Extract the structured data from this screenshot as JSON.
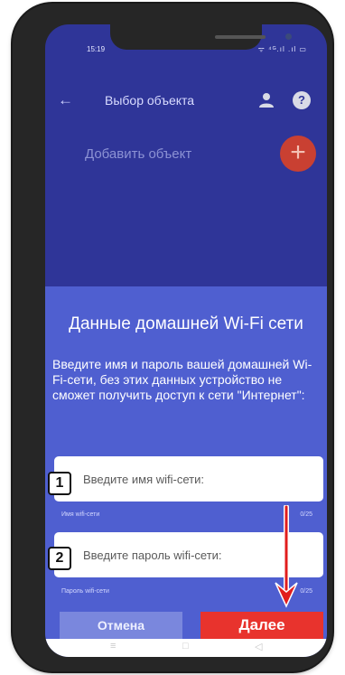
{
  "status_bar": {
    "time": "15:19",
    "icons_text": "ᯤ ⁴ᴳ.ıl .ıl ▭"
  },
  "toolbar": {
    "title": "Выбор объекта",
    "back_icon": "←",
    "help_icon": "?"
  },
  "add_object": {
    "label": "Добавить объект",
    "button_icon": "+"
  },
  "wifi_dialog": {
    "title": "Данные домашней Wi-Fi сети",
    "description": "Введите имя и пароль вашей домашней Wi-Fi-сети, без этих данных устройство не сможет получить доступ к сети \"Интернет\":",
    "name_field": {
      "step_number": "1",
      "placeholder": "Введите имя wifi-сети:",
      "helper": "Имя wifi-сети",
      "counter": "0/25"
    },
    "password_field": {
      "step_number": "2",
      "placeholder": "Введите пароль wifi-сети:",
      "helper": "Пароль wifi-сети",
      "counter": "0/25"
    },
    "cancel_label": "Отмена",
    "next_label": "Далее"
  },
  "nav_bar": {
    "menu_icon": "≡",
    "home_icon": "□",
    "back_icon": "◁"
  },
  "colors": {
    "app_background": "#2f3598",
    "dialog_background": "#4f5fd0",
    "accent_red": "#e8332d",
    "cancel_button": "#7a87dd"
  }
}
